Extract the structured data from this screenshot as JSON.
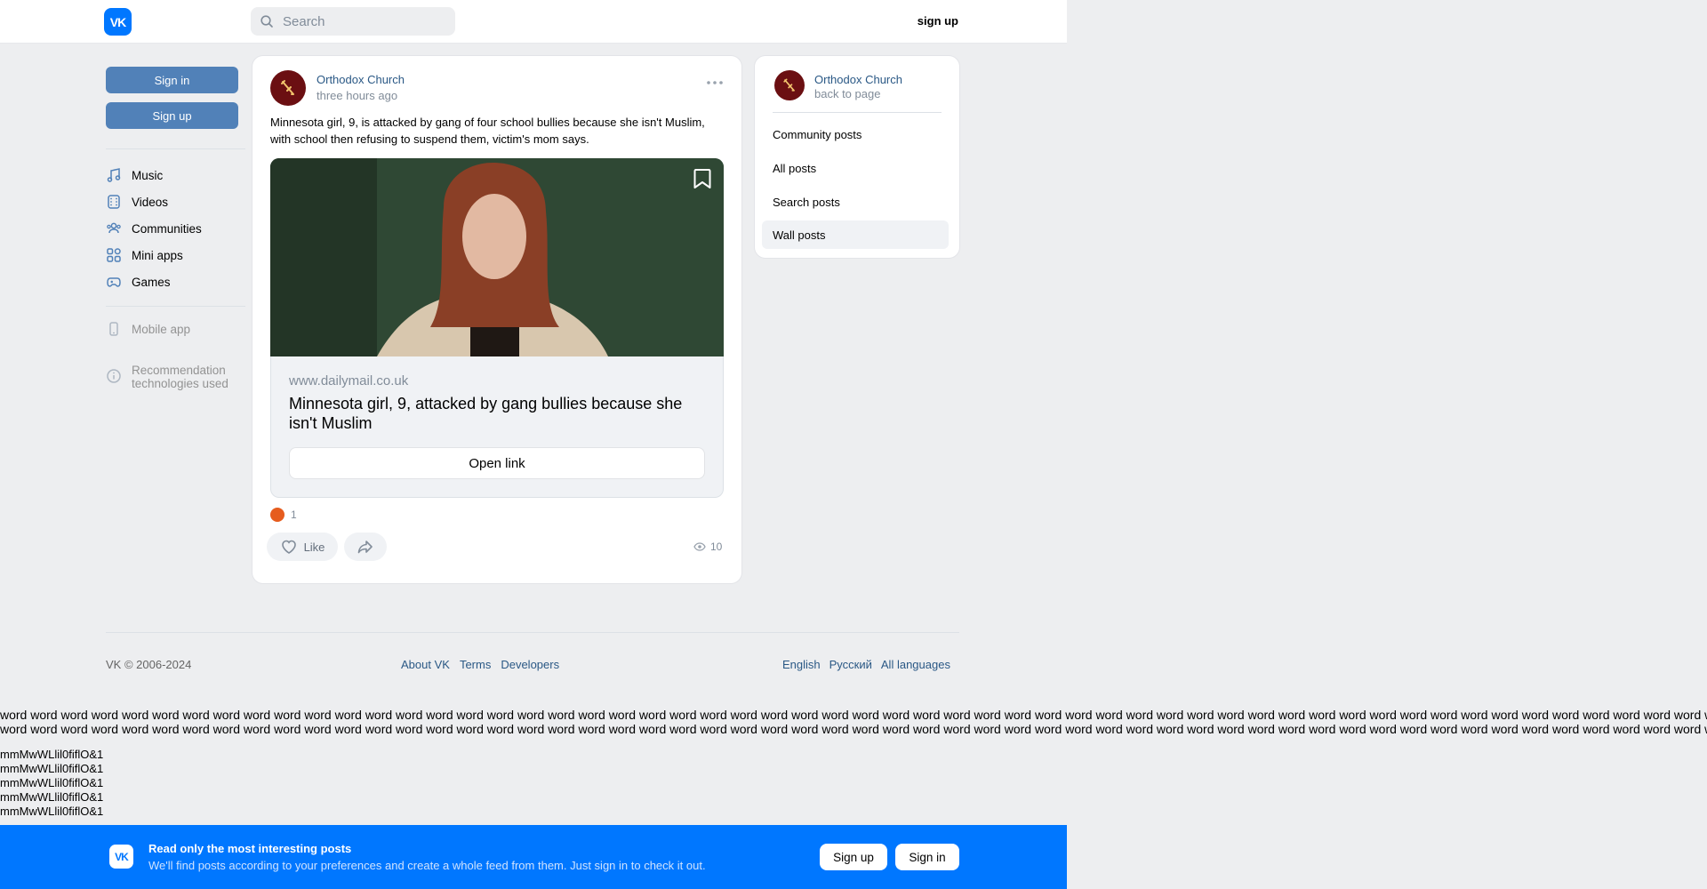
{
  "header": {
    "logo_text": "VK",
    "search_placeholder": "Search",
    "signup_label": "sign up"
  },
  "sidebar": {
    "signin_label": "Sign in",
    "signup_label": "Sign up",
    "items": [
      {
        "label": "Music",
        "icon": "music-note-icon"
      },
      {
        "label": "Videos",
        "icon": "video-icon"
      },
      {
        "label": "Communities",
        "icon": "users-icon"
      },
      {
        "label": "Mini apps",
        "icon": "grid-icon"
      },
      {
        "label": "Games",
        "icon": "gamepad-icon"
      }
    ],
    "mobile_app_label": "Mobile app",
    "recommendation_line1": "Recommendation",
    "recommendation_line2": "technologies used"
  },
  "post": {
    "author": "Orthodox Church",
    "time": "three hours ago",
    "text": "Minnesota girl, 9, is attacked by gang of four school bullies because she isn't Muslim, with school then refusing to suspend them, victim's mom says.",
    "link_domain": "www.dailymail.co.uk",
    "link_title": "Minnesota girl, 9, attacked by gang bullies because she isn't Muslim",
    "open_link_label": "Open link",
    "reaction_count": "1",
    "like_label": "Like",
    "views": "10"
  },
  "right_panel": {
    "name": "Orthodox Church",
    "back_label": "back to page",
    "items": [
      "Community posts",
      "All posts",
      "Search posts",
      "Wall posts"
    ],
    "active_item": "Wall posts"
  },
  "footer": {
    "copyright": "VK © 2006-2024",
    "links": [
      "About VK",
      "Terms",
      "Developers"
    ],
    "languages": [
      "English",
      "Русский",
      "All languages"
    ]
  },
  "filler": {
    "word_line": "word word word word word word word word word word word word word word word word word word word word word word word word word word word word word word word word word word word word word word word word word word word word word word word word word word word word word word word word word word word word",
    "glyph_line": "mmMwWLlil0fiflO&1"
  },
  "banner": {
    "logo_text": "VK",
    "title": "Read only the most interesting posts",
    "subtitle": "We'll find posts according to your preferences and create a whole feed from them. Just sign in to check it out.",
    "signup_label": "Sign up",
    "signin_label": "Sign in"
  },
  "colors": {
    "accent": "#0077ff",
    "button_blue": "#5181b8",
    "link": "#2a5885",
    "background": "#edeef0"
  }
}
